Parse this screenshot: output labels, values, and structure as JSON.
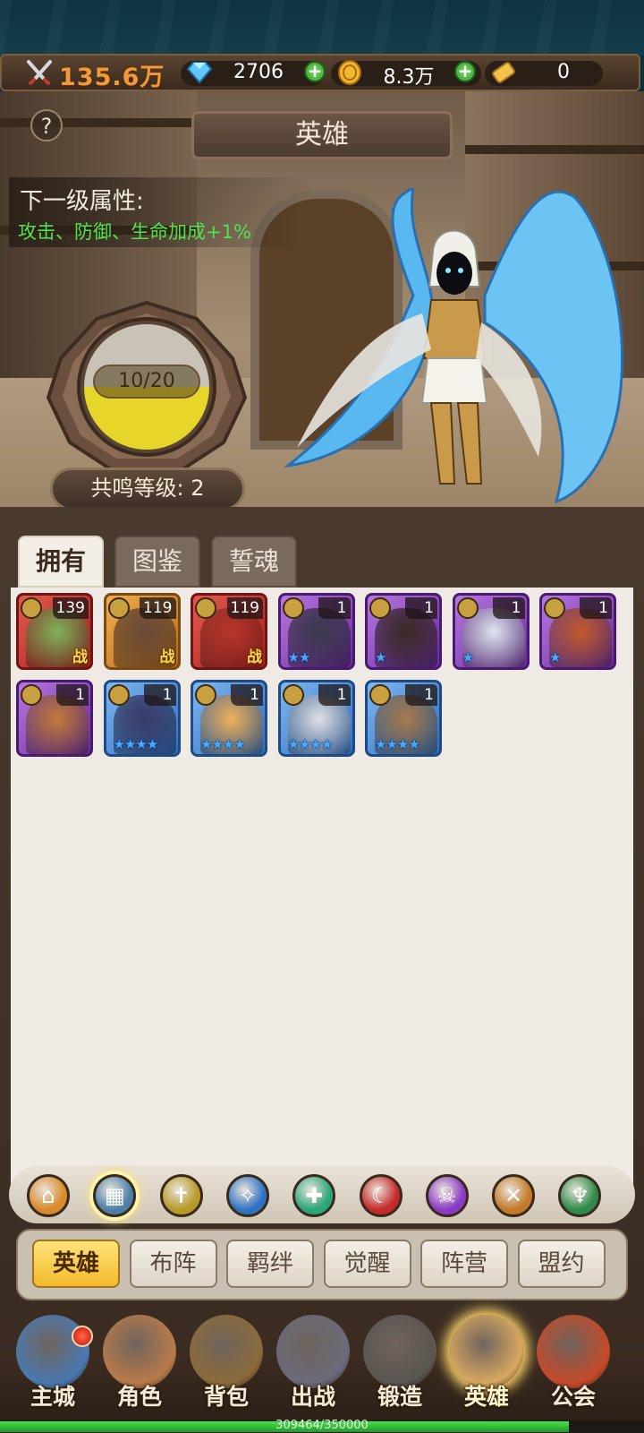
{
  "resources": {
    "power": "135.6万",
    "diamonds": "2706",
    "gold": "8.3万",
    "tickets": "0"
  },
  "header": {
    "title": "英雄",
    "help": "?",
    "attr_title": "下一级属性:",
    "attr_text": "攻击、防御、生命加成+1%"
  },
  "resonance": {
    "progress_label": "10/20",
    "progress_value": 0.5,
    "level_label": "共鸣等级: 2"
  },
  "tabs": [
    "拥有",
    "图鉴",
    "誓魂"
  ],
  "heroes": [
    {
      "level": "139",
      "frame": "red",
      "class_icon": "shield-class-icon",
      "stars": "",
      "tag": "战"
    },
    {
      "level": "119",
      "frame": "orange",
      "class_icon": "axe-class-icon",
      "stars": "",
      "tag": "战"
    },
    {
      "level": "119",
      "frame": "red",
      "class_icon": "claw-class-icon",
      "stars": "",
      "tag": "战"
    },
    {
      "level": "1",
      "frame": "purple",
      "class_icon": "claw-class-icon",
      "stars": "★★",
      "tag": ""
    },
    {
      "level": "1",
      "frame": "purple",
      "class_icon": "healer-class-icon",
      "stars": "★",
      "tag": ""
    },
    {
      "level": "1",
      "frame": "purple",
      "class_icon": "staff-class-icon",
      "stars": "★",
      "tag": ""
    },
    {
      "level": "1",
      "frame": "purple",
      "class_icon": "shield-class-icon",
      "stars": "★",
      "tag": ""
    },
    {
      "level": "1",
      "frame": "purple",
      "class_icon": "axe-class-icon",
      "stars": "",
      "tag": ""
    },
    {
      "level": "1",
      "frame": "blue",
      "class_icon": "axe-class-icon",
      "stars": "★★★★",
      "tag": ""
    },
    {
      "level": "1",
      "frame": "blue",
      "class_icon": "staff-class-icon",
      "stars": "★★★★",
      "tag": ""
    },
    {
      "level": "1",
      "frame": "blue",
      "class_icon": "skull-class-icon",
      "stars": "★★★★",
      "tag": ""
    },
    {
      "level": "1",
      "frame": "blue",
      "class_icon": "shield-class-icon",
      "stars": "★★★★",
      "tag": ""
    }
  ],
  "filters": [
    {
      "name": "filter-all",
      "glyph": "⌂",
      "color": "#d98a2a"
    },
    {
      "name": "filter-grid",
      "glyph": "▦",
      "color": "#4d7fa8"
    },
    {
      "name": "filter-shield",
      "glyph": "✝",
      "color": "#b79a28"
    },
    {
      "name": "filter-staff",
      "glyph": "✧",
      "color": "#2f72c4"
    },
    {
      "name": "filter-healer",
      "glyph": "✚",
      "color": "#2aa67a"
    },
    {
      "name": "filter-claw",
      "glyph": "☾",
      "color": "#c42a2a"
    },
    {
      "name": "filter-skull",
      "glyph": "☠",
      "color": "#8a3ac4"
    },
    {
      "name": "filter-axe",
      "glyph": "✕",
      "color": "#c47a2a"
    },
    {
      "name": "filter-demon",
      "glyph": "♆",
      "color": "#2f8a4a"
    }
  ],
  "sub_tabs": [
    "英雄",
    "布阵",
    "羁绊",
    "觉醒",
    "阵营",
    "盟约"
  ],
  "nav": [
    {
      "label": "主城",
      "art": "castle-icon",
      "color": "#4a78b0"
    },
    {
      "label": "角色",
      "art": "character-icon",
      "color": "#b87a4a"
    },
    {
      "label": "背包",
      "art": "backpack-icon",
      "color": "#8a6a3a"
    },
    {
      "label": "出战",
      "art": "crossed-swords-icon",
      "color": "#6a6a7a"
    },
    {
      "label": "锻造",
      "art": "anvil-icon",
      "color": "#5a5550"
    },
    {
      "label": "英雄",
      "art": "fist-icon",
      "color": "#d8a860"
    },
    {
      "label": "公会",
      "art": "guild-banner-icon",
      "color": "#c44a2a"
    }
  ],
  "exp": {
    "text": "309464/350000",
    "value": 0.884
  }
}
